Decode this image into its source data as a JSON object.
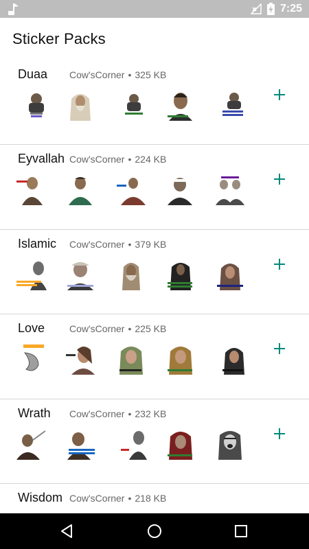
{
  "status_bar": {
    "time": "7:25"
  },
  "header": {
    "title": "Sticker Packs"
  },
  "packs": [
    {
      "name": "Duaa",
      "publisher": "Cow'sCorner",
      "separator": "•",
      "size": "325 KB"
    },
    {
      "name": "Eyvallah",
      "publisher": "Cow'sCorner",
      "separator": "•",
      "size": "224 KB"
    },
    {
      "name": "Islamic",
      "publisher": "Cow'sCorner",
      "separator": "•",
      "size": "379 KB"
    },
    {
      "name": "Love",
      "publisher": "Cow'sCorner",
      "separator": "•",
      "size": "225 KB"
    },
    {
      "name": "Wrath",
      "publisher": "Cow'sCorner",
      "separator": "•",
      "size": "232 KB"
    },
    {
      "name": "Wisdom",
      "publisher": "Cow'sCorner",
      "separator": "•",
      "size": "218 KB"
    }
  ],
  "colors": {
    "accent": "#00897b",
    "status_bar": "#bdbdbd",
    "nav_bar": "#000000"
  },
  "icons": {
    "status_left": "music-note-icon",
    "status_signal": "no-signal-icon",
    "status_battery": "battery-charging-icon",
    "add": "plus-icon",
    "nav_back": "back-triangle-icon",
    "nav_home": "home-circle-icon",
    "nav_recents": "recents-square-icon"
  }
}
